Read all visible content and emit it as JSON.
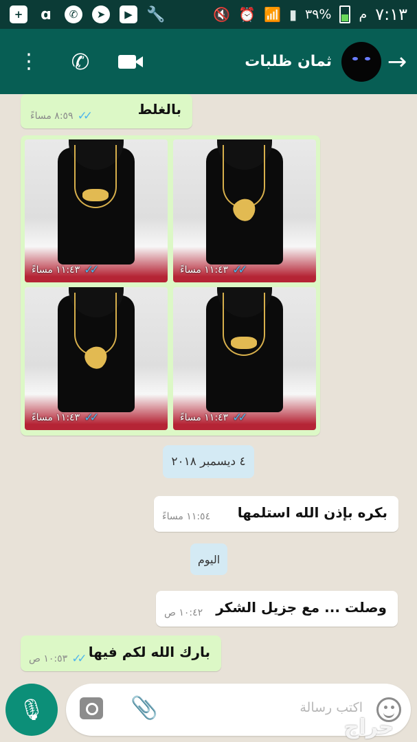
{
  "status_bar": {
    "time": "٧:١٣",
    "ampm": "م",
    "battery": "٣٩%",
    "left_icons": [
      "add-icon",
      "ali-icon",
      "whatsapp-icon",
      "telegram-icon",
      "youtube-icon",
      "wrench-icon"
    ]
  },
  "header": {
    "contact_name": "ثمان ظلبات",
    "bg_color": "#075e54"
  },
  "messages": [
    {
      "type": "out",
      "text": "بالغلط",
      "time": "٨:٥٩ مساءً"
    },
    {
      "type": "images",
      "tiles": [
        {
          "time": "١١:٤٣ مساءً"
        },
        {
          "time": "١١:٤٣ مساءً"
        },
        {
          "time": "١١:٤٣ مساءً"
        },
        {
          "time": "١١:٤٣ مساءً"
        }
      ]
    },
    {
      "type": "date",
      "text": "٤ ديسمبر ٢٠١٨"
    },
    {
      "type": "in",
      "text": "بكره بإذن الله استلمها",
      "time": "١١:٥٤ مساءً"
    },
    {
      "type": "date",
      "text": "اليوم"
    },
    {
      "type": "in",
      "text": "وصلت ... مع جزيل الشكر",
      "time": "١٠:٤٢ ص"
    },
    {
      "type": "out",
      "text": "بارك الله لكم فيها",
      "time": "١٠:٥٣ ص"
    }
  ],
  "composer": {
    "placeholder": "اكتب رسالة",
    "watermark": "حراج"
  }
}
